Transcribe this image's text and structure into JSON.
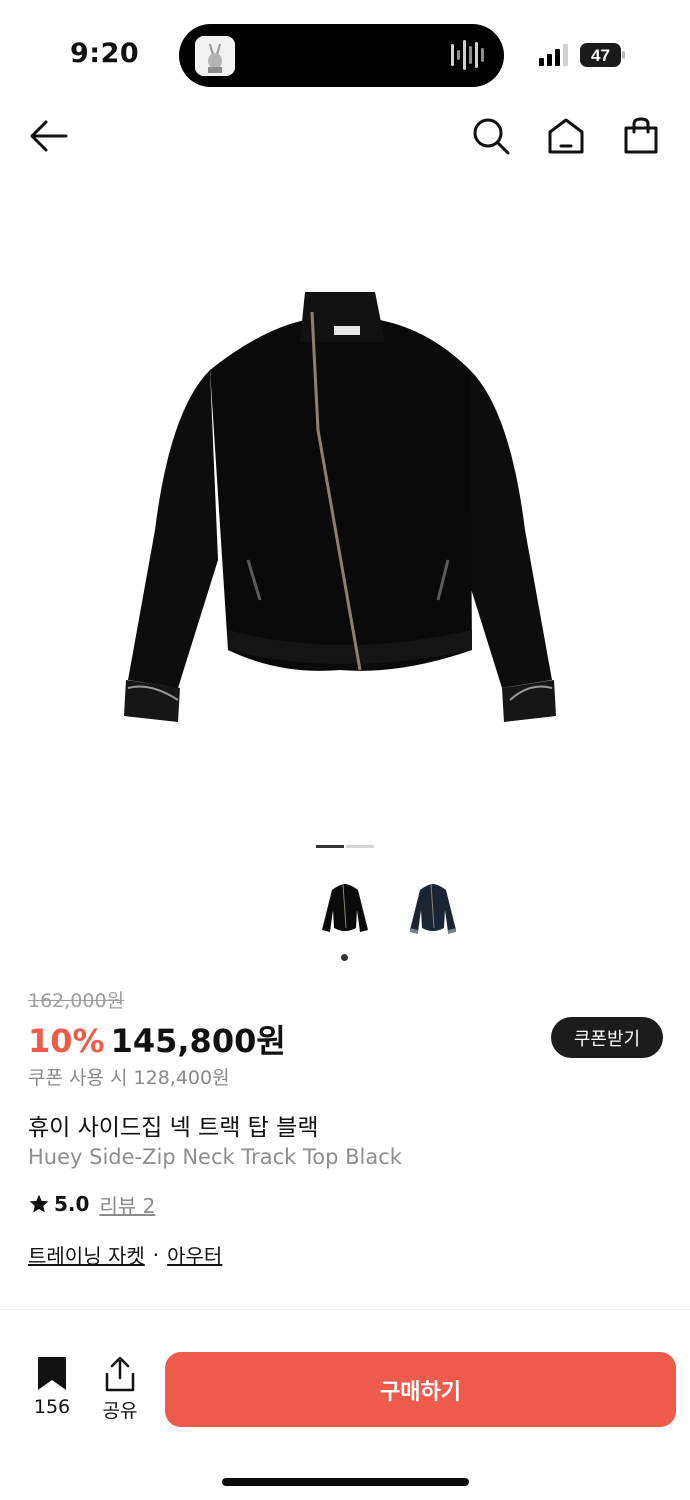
{
  "status": {
    "time": "9:20",
    "battery": "47"
  },
  "nav": {
    "back_icon": "arrow-left-icon",
    "search_icon": "search-icon",
    "home_icon": "home-icon",
    "cart_icon": "shopping-bag-icon"
  },
  "gallery": {
    "image_count": 2,
    "current_index": 0,
    "thumbnails": [
      {
        "name": "black"
      },
      {
        "name": "navy"
      }
    ]
  },
  "product": {
    "original_price": "162,000원",
    "discount": "10%",
    "price": "145,800원",
    "coupon_button": "쿠폰받기",
    "coupon_price": "쿠폰 사용 시 128,400원",
    "name_ko": "휴이 사이드집 넥 트랙 탑 블랙",
    "name_en": "Huey Side-Zip Neck Track Top Black",
    "rating": "5.0",
    "review_label": "리뷰 2",
    "categories": [
      "트레이닝 자켓",
      "아우터"
    ],
    "category_separator": "·"
  },
  "bottom_bar": {
    "bookmark_count": "156",
    "share_label": "공유",
    "buy_label": "구매하기"
  },
  "colors": {
    "accent": "#EE5B4C",
    "discount": "#EE5B48",
    "dark_button": "#1C1C1C"
  }
}
